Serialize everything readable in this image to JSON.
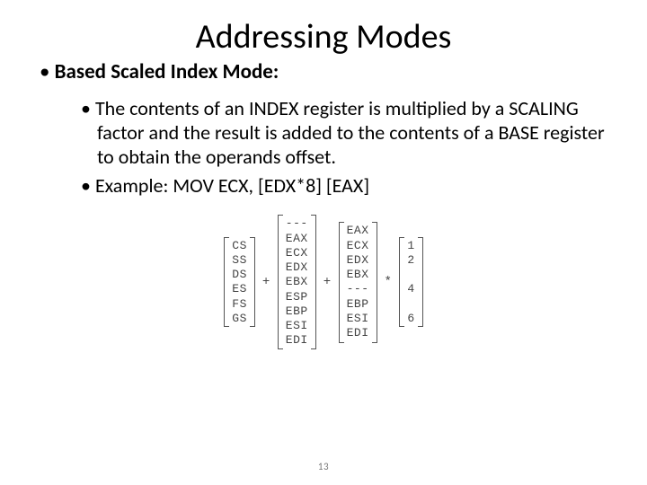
{
  "title": "Addressing Modes",
  "subheading": "Based Scaled Index Mode:",
  "bullets": {
    "b1": "The contents of an INDEX register is multiplied by a SCALING factor and the result is added to the contents of a BASE register to obtain the operands offset.",
    "b2": "Example: MOV ECX, [EDX*8] [EAX]"
  },
  "diagram": {
    "seg": [
      "CS",
      "SS",
      "DS",
      "ES",
      "FS",
      "GS"
    ],
    "base": [
      "---",
      "EAX",
      "ECX",
      "EDX",
      "EBX",
      "ESP",
      "EBP",
      "ESI",
      "EDI"
    ],
    "index": [
      "EAX",
      "ECX",
      "EDX",
      "EBX",
      "---",
      "EBP",
      "ESI",
      "EDI"
    ],
    "scale": [
      "1",
      "2",
      "",
      "4",
      "",
      "6"
    ],
    "op_plus": "+",
    "op_star": "*"
  },
  "page": "13"
}
